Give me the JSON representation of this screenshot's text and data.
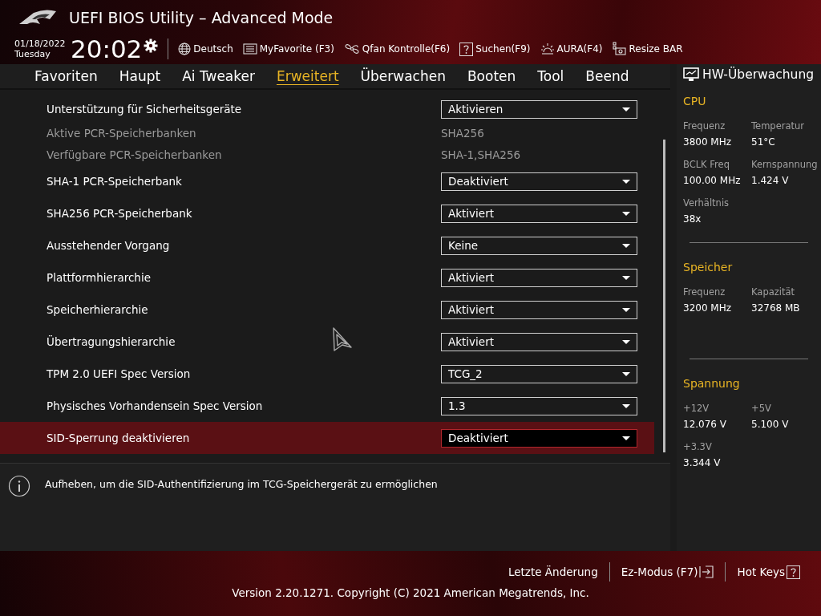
{
  "window": {
    "title": "UEFI BIOS Utility – Advanced Mode"
  },
  "header": {
    "date": "01/18/2022",
    "day": "Tuesday",
    "time": "20:02",
    "toolbar": [
      {
        "kind": "globe",
        "label": "Deutsch"
      },
      {
        "kind": "list",
        "label": "MyFavorite (F3)"
      },
      {
        "kind": "fan",
        "label": "Qfan Kontrolle(F6)"
      },
      {
        "kind": "help",
        "label": "Suchen(F9)"
      },
      {
        "kind": "light",
        "label": "AURA(F4)"
      },
      {
        "kind": "card",
        "label": "Resize BAR"
      }
    ]
  },
  "tabs": [
    {
      "label": "Favoriten",
      "selected": false
    },
    {
      "label": "Haupt",
      "selected": false
    },
    {
      "label": "Ai Tweaker",
      "selected": false
    },
    {
      "label": "Erweitert",
      "selected": true
    },
    {
      "label": "Überwachen",
      "selected": false
    },
    {
      "label": "Booten",
      "selected": false
    },
    {
      "label": "Tool",
      "selected": false
    },
    {
      "label": "Beend",
      "selected": false
    }
  ],
  "settings": [
    {
      "kind": "dropdown",
      "label": "Unterstützung für Sicherheitsgeräte",
      "value": "Aktivieren",
      "selected": false
    },
    {
      "kind": "info",
      "label": "Aktive PCR-Speicherbanken",
      "value": "SHA256",
      "selected": false
    },
    {
      "kind": "info",
      "label": "Verfügbare PCR-Speicherbanken",
      "value": "SHA-1,SHA256",
      "selected": false
    },
    {
      "kind": "dropdown",
      "label": "SHA-1 PCR-Speicherbank",
      "value": "Deaktiviert",
      "selected": false
    },
    {
      "kind": "dropdown",
      "label": "SHA256 PCR-Speicherbank",
      "value": "Aktiviert",
      "selected": false
    },
    {
      "kind": "dropdown",
      "label": "Ausstehender Vorgang",
      "value": "Keine",
      "selected": false
    },
    {
      "kind": "dropdown",
      "label": "Plattformhierarchie",
      "value": "Aktiviert",
      "selected": false
    },
    {
      "kind": "dropdown",
      "label": "Speicherhierarchie",
      "value": "Aktiviert",
      "selected": false
    },
    {
      "kind": "dropdown",
      "label": "Übertragungshierarchie",
      "value": "Aktiviert",
      "selected": false
    },
    {
      "kind": "dropdown",
      "label": "TPM 2.0 UEFI Spec Version",
      "value": "TCG_2",
      "selected": false
    },
    {
      "kind": "dropdown",
      "label": "Physisches Vorhandensein Spec Version",
      "value": "1.3",
      "selected": false
    },
    {
      "kind": "dropdown",
      "label": "SID-Sperrung deaktivieren",
      "value": "Deaktiviert",
      "selected": true
    }
  ],
  "help_text": "Aufheben, um die SID-Authentifizierung im TCG-Speichergerät zu ermöglichen",
  "hw_monitor": {
    "title": "HW-Überwachung",
    "sections": [
      {
        "title": "CPU",
        "items": [
          {
            "label": "Frequenz",
            "value": "3800 MHz"
          },
          {
            "label": "Temperatur",
            "value": "51°C"
          },
          {
            "label": "BCLK Freq",
            "value": "100.00 MHz"
          },
          {
            "label": "Kernspannung",
            "value": "1.424 V"
          },
          {
            "label": "Verhältnis",
            "value": "38x"
          }
        ]
      },
      {
        "title": "Speicher",
        "items": [
          {
            "label": "Frequenz",
            "value": "3200 MHz"
          },
          {
            "label": "Kapazität",
            "value": "32768 MB"
          }
        ]
      },
      {
        "title": "Spannung",
        "items": [
          {
            "label": "+12V",
            "value": "12.076 V"
          },
          {
            "label": "+5V",
            "value": "5.100 V"
          },
          {
            "label": "+3.3V",
            "value": "3.344 V"
          }
        ]
      }
    ]
  },
  "footer": {
    "buttons": [
      {
        "kind": "plain",
        "label": "Letzte Änderung"
      },
      {
        "kind": "exit",
        "label": "Ez-Modus (F7)"
      },
      {
        "kind": "help",
        "label": "Hot Keys"
      }
    ],
    "version": "Version 2.20.1271. Copyright (C) 2021 American Megatrends, Inc."
  }
}
